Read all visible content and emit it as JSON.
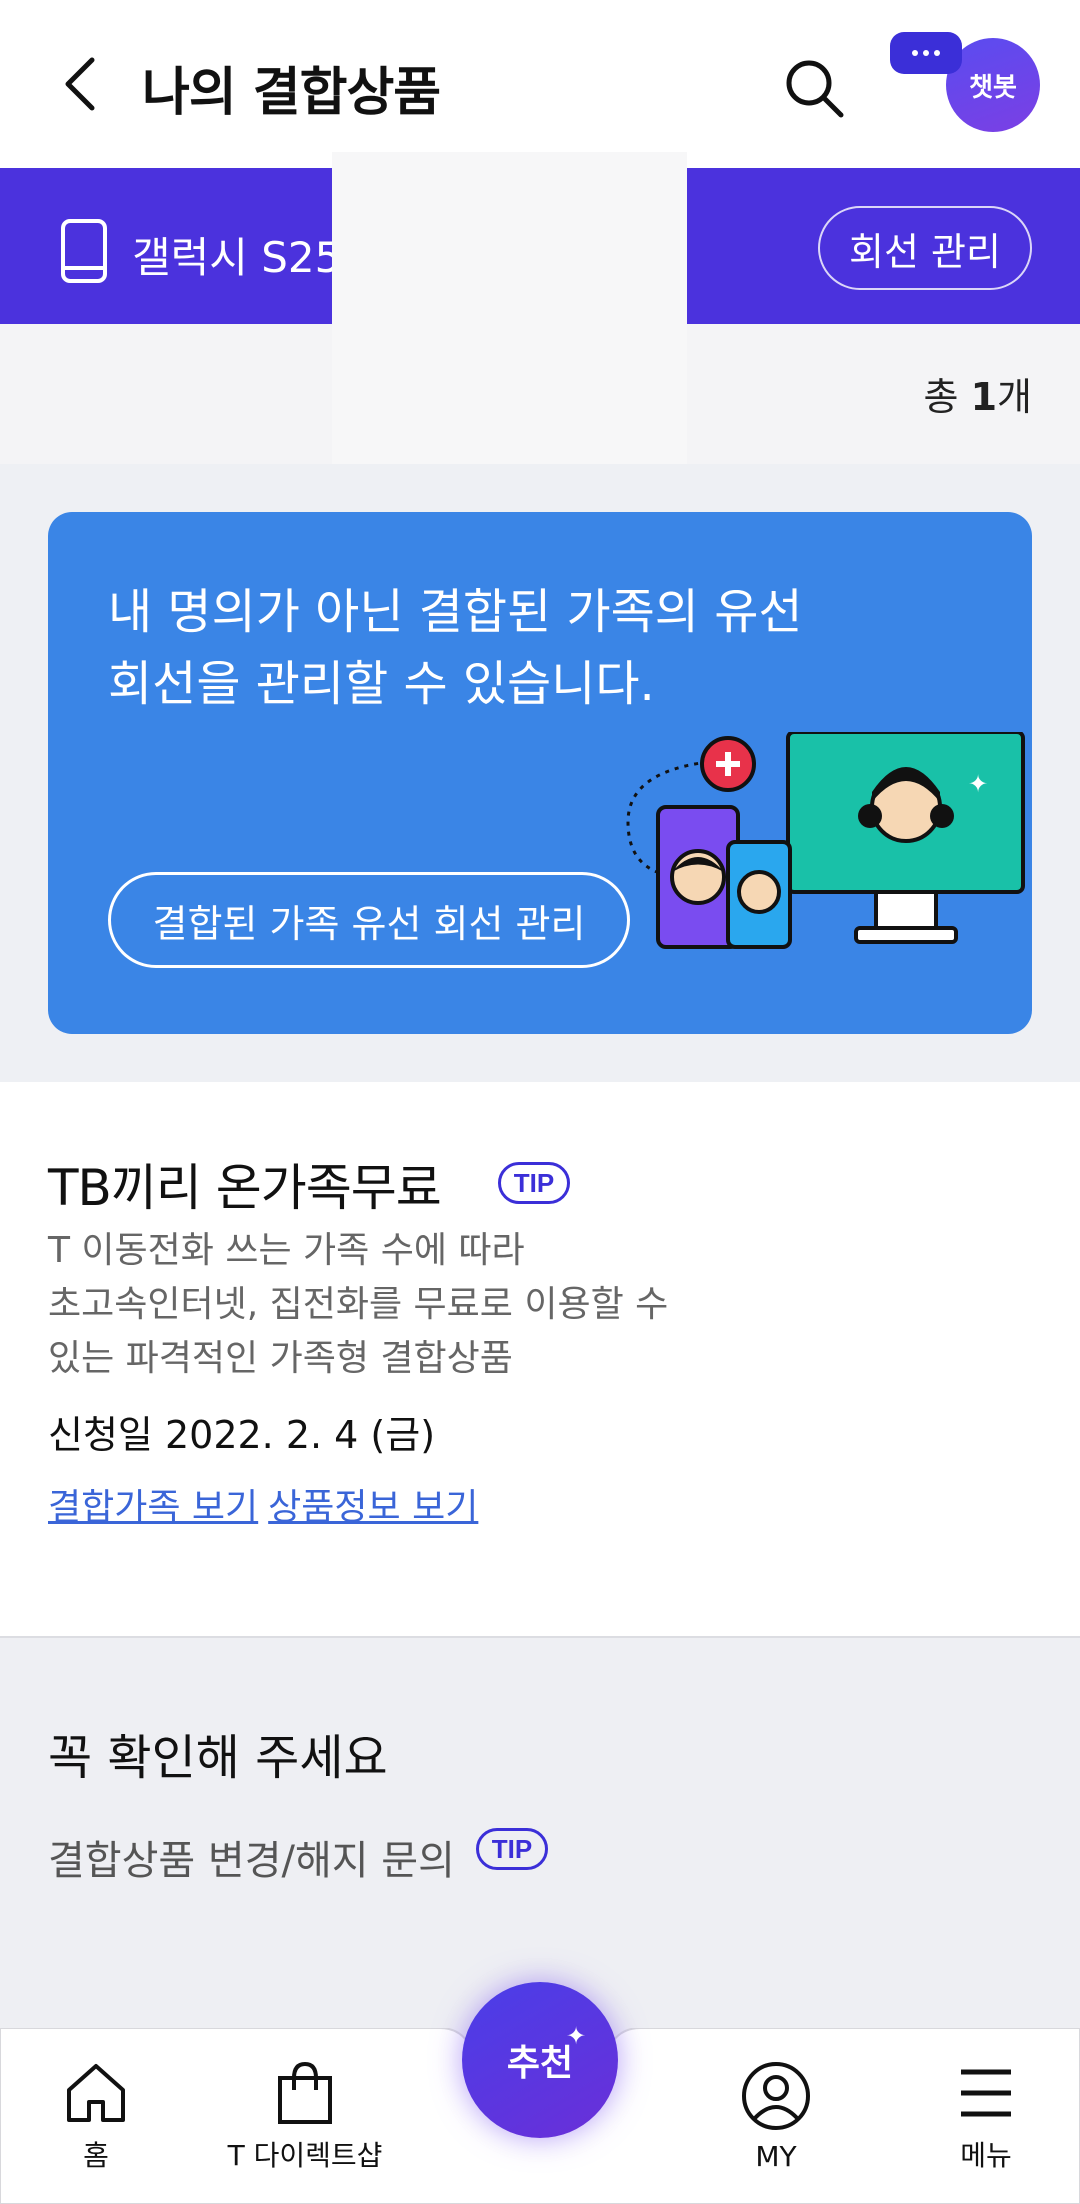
{
  "header": {
    "title": "나의 결합상품",
    "chatbot_label": "챗봇"
  },
  "line_bar": {
    "device_name": "갤럭시 S25",
    "manage_button": "회선 관리"
  },
  "count": {
    "prefix": "총 ",
    "number": "1",
    "suffix": "개"
  },
  "banner": {
    "line1": "내 명의가 아닌 결합된 가족의 유선",
    "line2": "회선을 관리할 수 있습니다.",
    "button": "결합된 가족 유선 회선 관리"
  },
  "product": {
    "title": "TB끼리 온가족무료",
    "tip": "TIP",
    "desc1": "T 이동전화 쓰는 가족 수에 따라",
    "desc2": "초고속인터넷, 집전화를 무료로 이용할 수",
    "desc3": "있는 파격적인 가족형 결합상품",
    "date": "신청일 2022. 2. 4 (금)",
    "link1": "결합가족 보기",
    "link2": "상품정보 보기"
  },
  "notice": {
    "title": "꼭 확인해 주세요",
    "item": "결합상품 변경/해지 문의",
    "tip": "TIP"
  },
  "bottom_nav": {
    "home": "홈",
    "shop": "T 다이렉트샵",
    "recommend": "추천",
    "my": "MY",
    "menu": "메뉴"
  },
  "colors": {
    "primary": "#4b32dd",
    "banner": "#3a85e6",
    "link": "#3a65d8"
  }
}
